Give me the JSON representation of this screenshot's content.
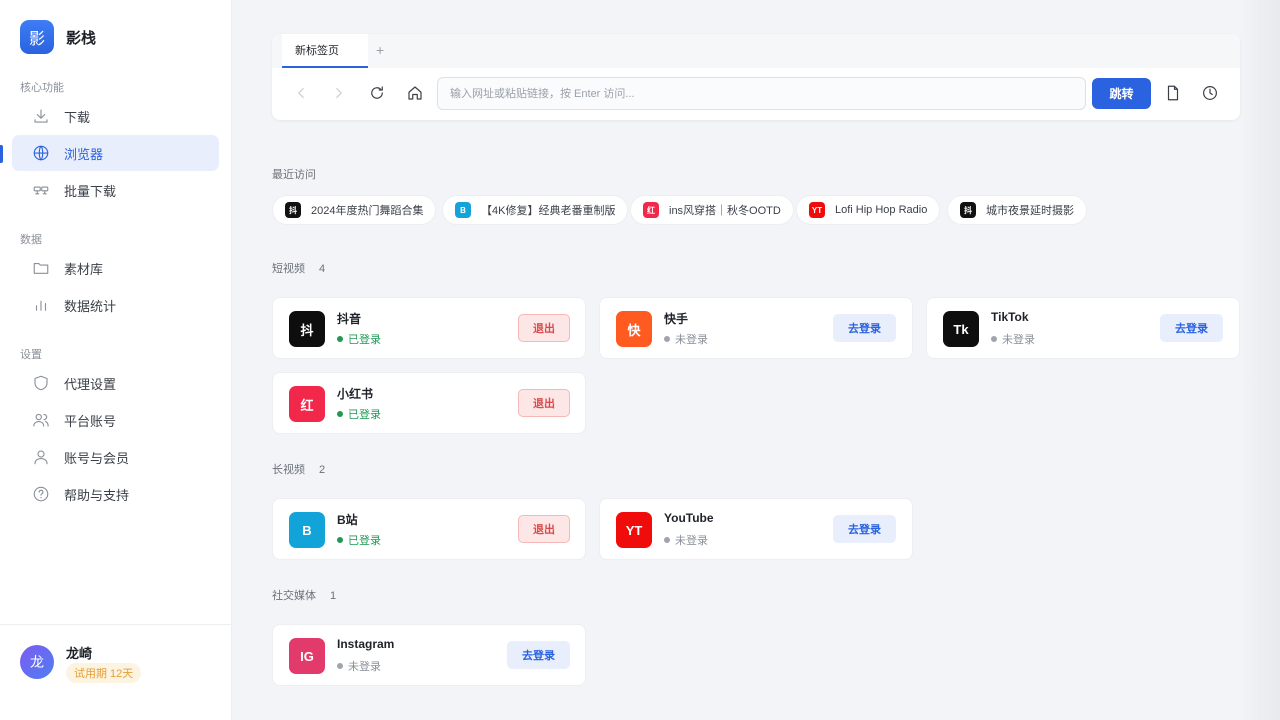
{
  "brand": {
    "logo_char": "影",
    "name": "影栈"
  },
  "sidebar": {
    "sections": [
      {
        "title": "核心功能"
      },
      {
        "title": "数据"
      },
      {
        "title": "设置"
      }
    ],
    "items": [
      {
        "label": "下载",
        "icon": "download-icon"
      },
      {
        "label": "浏览器",
        "icon": "globe-icon",
        "active": true
      },
      {
        "label": "批量下载",
        "icon": "batch-icon"
      },
      {
        "label": "素材库",
        "icon": "folder-icon"
      },
      {
        "label": "数据统计",
        "icon": "bar-chart-icon"
      },
      {
        "label": "代理设置",
        "icon": "shield-icon"
      },
      {
        "label": "平台账号",
        "icon": "users-icon"
      },
      {
        "label": "账号与会员",
        "icon": "user-icon"
      },
      {
        "label": "帮助与支持",
        "icon": "help-icon"
      }
    ]
  },
  "user": {
    "avatar_char": "龙",
    "name": "龙崎",
    "trial": "试用期 12天"
  },
  "browser": {
    "tab_label": "新标签页",
    "tab_add": "+",
    "url_placeholder": "输入网址或粘贴链接，按 Enter 访问...",
    "go_label": "跳转"
  },
  "recent": {
    "title": "最近访问",
    "items": [
      {
        "label": "2024年度热门舞蹈合集",
        "icon_char": "抖",
        "color": "#111111"
      },
      {
        "label": "【4K修复】经典老番重制版",
        "icon_char": "B",
        "color": "#12a3d8"
      },
      {
        "label": "ins风穿搭｜秋冬OOTD",
        "icon_char": "红",
        "color": "#f2284a"
      },
      {
        "label": "Lofi Hip Hop Radio",
        "icon_char": "YT",
        "color": "#f10c0c"
      },
      {
        "label": "城市夜景延时摄影",
        "icon_char": "抖",
        "color": "#111111"
      }
    ]
  },
  "groups": {
    "short": {
      "title": "短视频",
      "count": "4",
      "items": [
        {
          "name": "抖音",
          "logo": "抖",
          "color": "#0e0e0e",
          "status": "已登录",
          "logged_in": true,
          "action": "退出"
        },
        {
          "name": "快手",
          "logo": "快",
          "color": "#ff5a1f",
          "status": "未登录",
          "logged_in": false,
          "action": "去登录"
        },
        {
          "name": "TikTok",
          "logo": "Tk",
          "color": "#0e0e0e",
          "status": "未登录",
          "logged_in": false,
          "action": "去登录"
        },
        {
          "name": "小红书",
          "logo": "红",
          "color": "#f2284a",
          "status": "已登录",
          "logged_in": true,
          "action": "退出"
        }
      ]
    },
    "long": {
      "title": "长视频",
      "count": "2",
      "items": [
        {
          "name": "B站",
          "logo": "B",
          "color": "#12a3d8",
          "status": "已登录",
          "logged_in": true,
          "action": "退出"
        },
        {
          "name": "YouTube",
          "logo": "YT",
          "color": "#f10c0c",
          "status": "未登录",
          "logged_in": false,
          "action": "去登录"
        }
      ]
    },
    "social": {
      "title": "社交媒体",
      "count": "1",
      "items": [
        {
          "name": "Instagram",
          "logo": "IG",
          "color": "#e23b6b",
          "status": "未登录",
          "logged_in": false,
          "action": "去登录"
        }
      ]
    }
  },
  "colors": {
    "accent": "#2a62e0",
    "logged_in": "#1e9a55",
    "logout": "#d94a4a",
    "trial": "#e2a03a"
  }
}
